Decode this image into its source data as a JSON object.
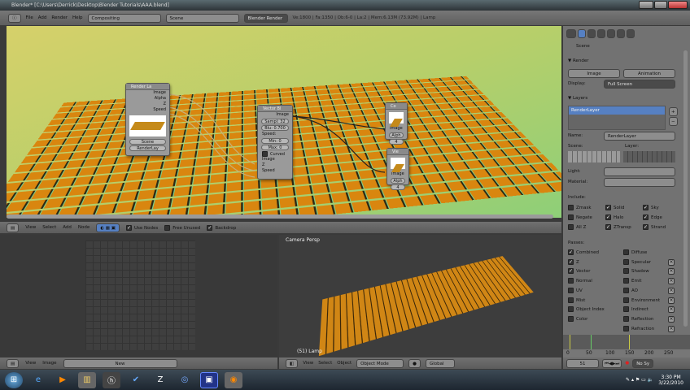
{
  "window": {
    "title": "Blender* [C:\\Users\\Derrick\\Desktop\\Blender Tutorials\\AAA.blend]"
  },
  "header": {
    "menus": [
      "File",
      "Add",
      "Render",
      "Help"
    ],
    "screen": "Compositing",
    "scene": "Scene",
    "engine": "Blender Render",
    "stats": "Ve:1800 | Fa:1350 | Ob:6-0 | La:2 | Mem:6.13M (73.92M) | Lamp"
  },
  "nodes": {
    "render_layers": {
      "title": "Render La",
      "outputs": [
        "Image",
        "Alpha",
        "Z",
        "Speed"
      ],
      "scene": "Scene",
      "layer": "RenderLay"
    },
    "vector_blur": {
      "title": "Vector Bl",
      "output": "Image",
      "samples": "Sampl: 32",
      "blur": "Blu: 0.700",
      "speed_label": "Speed:",
      "min": "Min: 0",
      "max": "Max: 0",
      "curved": "Curved",
      "inputs": [
        "Image",
        "Z",
        "Speed"
      ]
    },
    "composite": {
      "title": "Co",
      "input": "Image",
      "alpha": "Alph",
      "z": "4"
    },
    "viewer": {
      "title": "Vie",
      "input": "Image",
      "alpha": "Alph",
      "z": "4"
    }
  },
  "node_header": {
    "menus": [
      "View",
      "Select",
      "Add",
      "Node"
    ],
    "use_nodes": "Use Nodes",
    "free_unused": "Free Unused",
    "backdrop": "Backdrop"
  },
  "image_header": {
    "menus": [
      "View",
      "Image"
    ],
    "new": "New"
  },
  "view3d": {
    "label": "Camera Persp",
    "object": "(51) Lamp",
    "menus": [
      "View",
      "Select",
      "Object"
    ],
    "mode": "Object Mode",
    "orientation": "Global"
  },
  "props": {
    "context": "Scene",
    "render": {
      "title": "Render",
      "image": "Image",
      "animation": "Animation",
      "display_label": "Display:",
      "display": "Full Screen"
    },
    "layers": {
      "title": "Layers",
      "item": "RenderLayer",
      "name_label": "Name:",
      "name": "RenderLayer",
      "scene_label": "Scene:",
      "layer_label": "Layer:",
      "light_label": "Light:",
      "material_label": "Material:"
    },
    "include": {
      "label": "Include:",
      "items": [
        {
          "l": "Zmask",
          "c": false
        },
        {
          "l": "Solid",
          "c": true
        },
        {
          "l": "Sky",
          "c": true
        },
        {
          "l": "Negate",
          "c": false
        },
        {
          "l": "Halo",
          "c": true
        },
        {
          "l": "Edge",
          "c": true
        },
        {
          "l": "All Z",
          "c": false
        },
        {
          "l": "ZTransp",
          "c": true
        },
        {
          "l": "Strand",
          "c": true
        }
      ]
    },
    "passes": {
      "label": "Passes:",
      "left": [
        {
          "l": "Combined",
          "c": true
        },
        {
          "l": "Z",
          "c": true
        },
        {
          "l": "Vector",
          "c": true
        },
        {
          "l": "Normal",
          "c": false
        },
        {
          "l": "UV",
          "c": false
        },
        {
          "l": "Mist",
          "c": false
        },
        {
          "l": "Object Index",
          "c": false
        },
        {
          "l": "Color",
          "c": false
        }
      ],
      "right": [
        "Diffuse",
        "Specular",
        "Shadow",
        "Emit",
        "AO",
        "Environment",
        "Indirect",
        "Reflection",
        "Refraction"
      ]
    }
  },
  "timeline": {
    "ticks": [
      "0",
      "50",
      "100",
      "150",
      "200",
      "250"
    ],
    "frame": "51",
    "nosync": "No Sy"
  },
  "taskbar": {
    "time": "3:30 PM",
    "date": "3/22/2010"
  }
}
